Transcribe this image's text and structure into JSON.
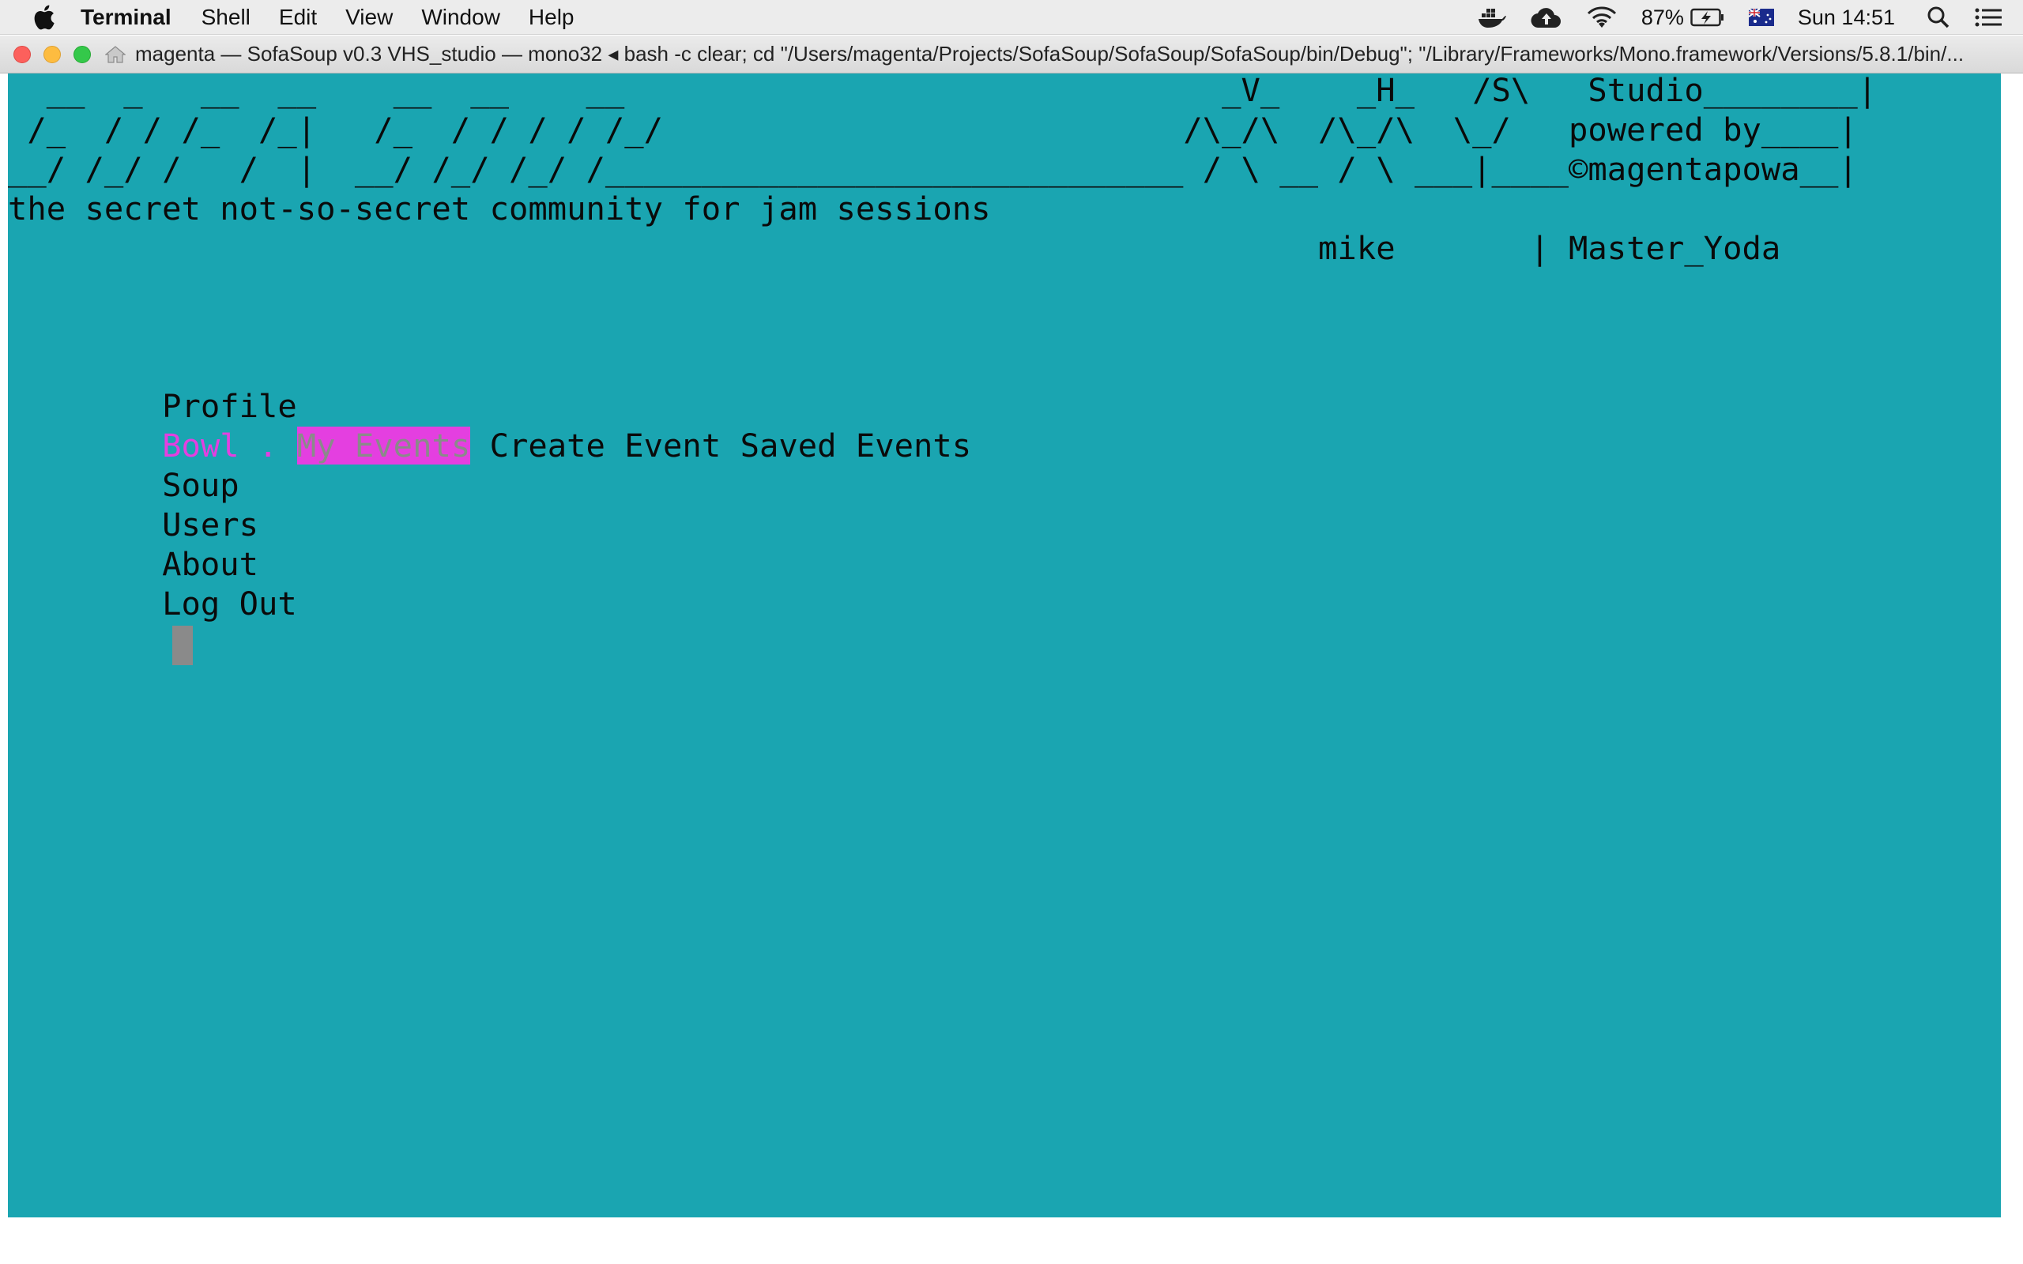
{
  "menubar": {
    "app_name": "Terminal",
    "menus": [
      "Shell",
      "Edit",
      "View",
      "Window",
      "Help"
    ],
    "battery": "87%",
    "clock": "Sun 14:51",
    "icons": [
      "docker-icon",
      "cloud-upload-icon",
      "wifi-icon",
      "battery-charging-icon",
      "flag-au-icon",
      "spotlight-search-icon",
      "notification-center-icon"
    ]
  },
  "window": {
    "title": "magenta — SofaSoup v0.3  VHS_studio — mono32 ◂ bash -c clear; cd \"/Users/magenta/Projects/SofaSoup/SofaSoup/SofaSoup/bin/Debug\"; \"/Library/Frameworks/Mono.framework/Versions/5.8.1/bin/..."
  },
  "terminal": {
    "banner_lines": [
      "  __  _   __  __    __  __    __                               _V_    _H_   /S\\   Studio________|",
      " /_  / / /_  /_|   /_  / / / / /_/                           /\\_/\\  /\\_/\\  \\_/   powered by____|",
      "__/ /_/ /   /  |  __/ /_/ /_/ /______________________________ / \\ __ / \\ ___|____©magentapowa__|"
    ],
    "tagline": "the secret not-so-secret community for jam sessions",
    "user_line": "                                                                    mike       | Master_Yoda",
    "menu": {
      "indent": "        ",
      "profile": "Profile",
      "bowl_prefix": "Bowl . ",
      "my_events": "My Events",
      "bowl_rest": " Create Event Saved Events",
      "soup": "Soup",
      "users": "Users",
      "about": "About",
      "logout": "Log Out"
    }
  },
  "colors": {
    "terminal_bg": "#1aa5b1",
    "highlight": "#e43fe0",
    "cursor": "#8a8a8a"
  }
}
